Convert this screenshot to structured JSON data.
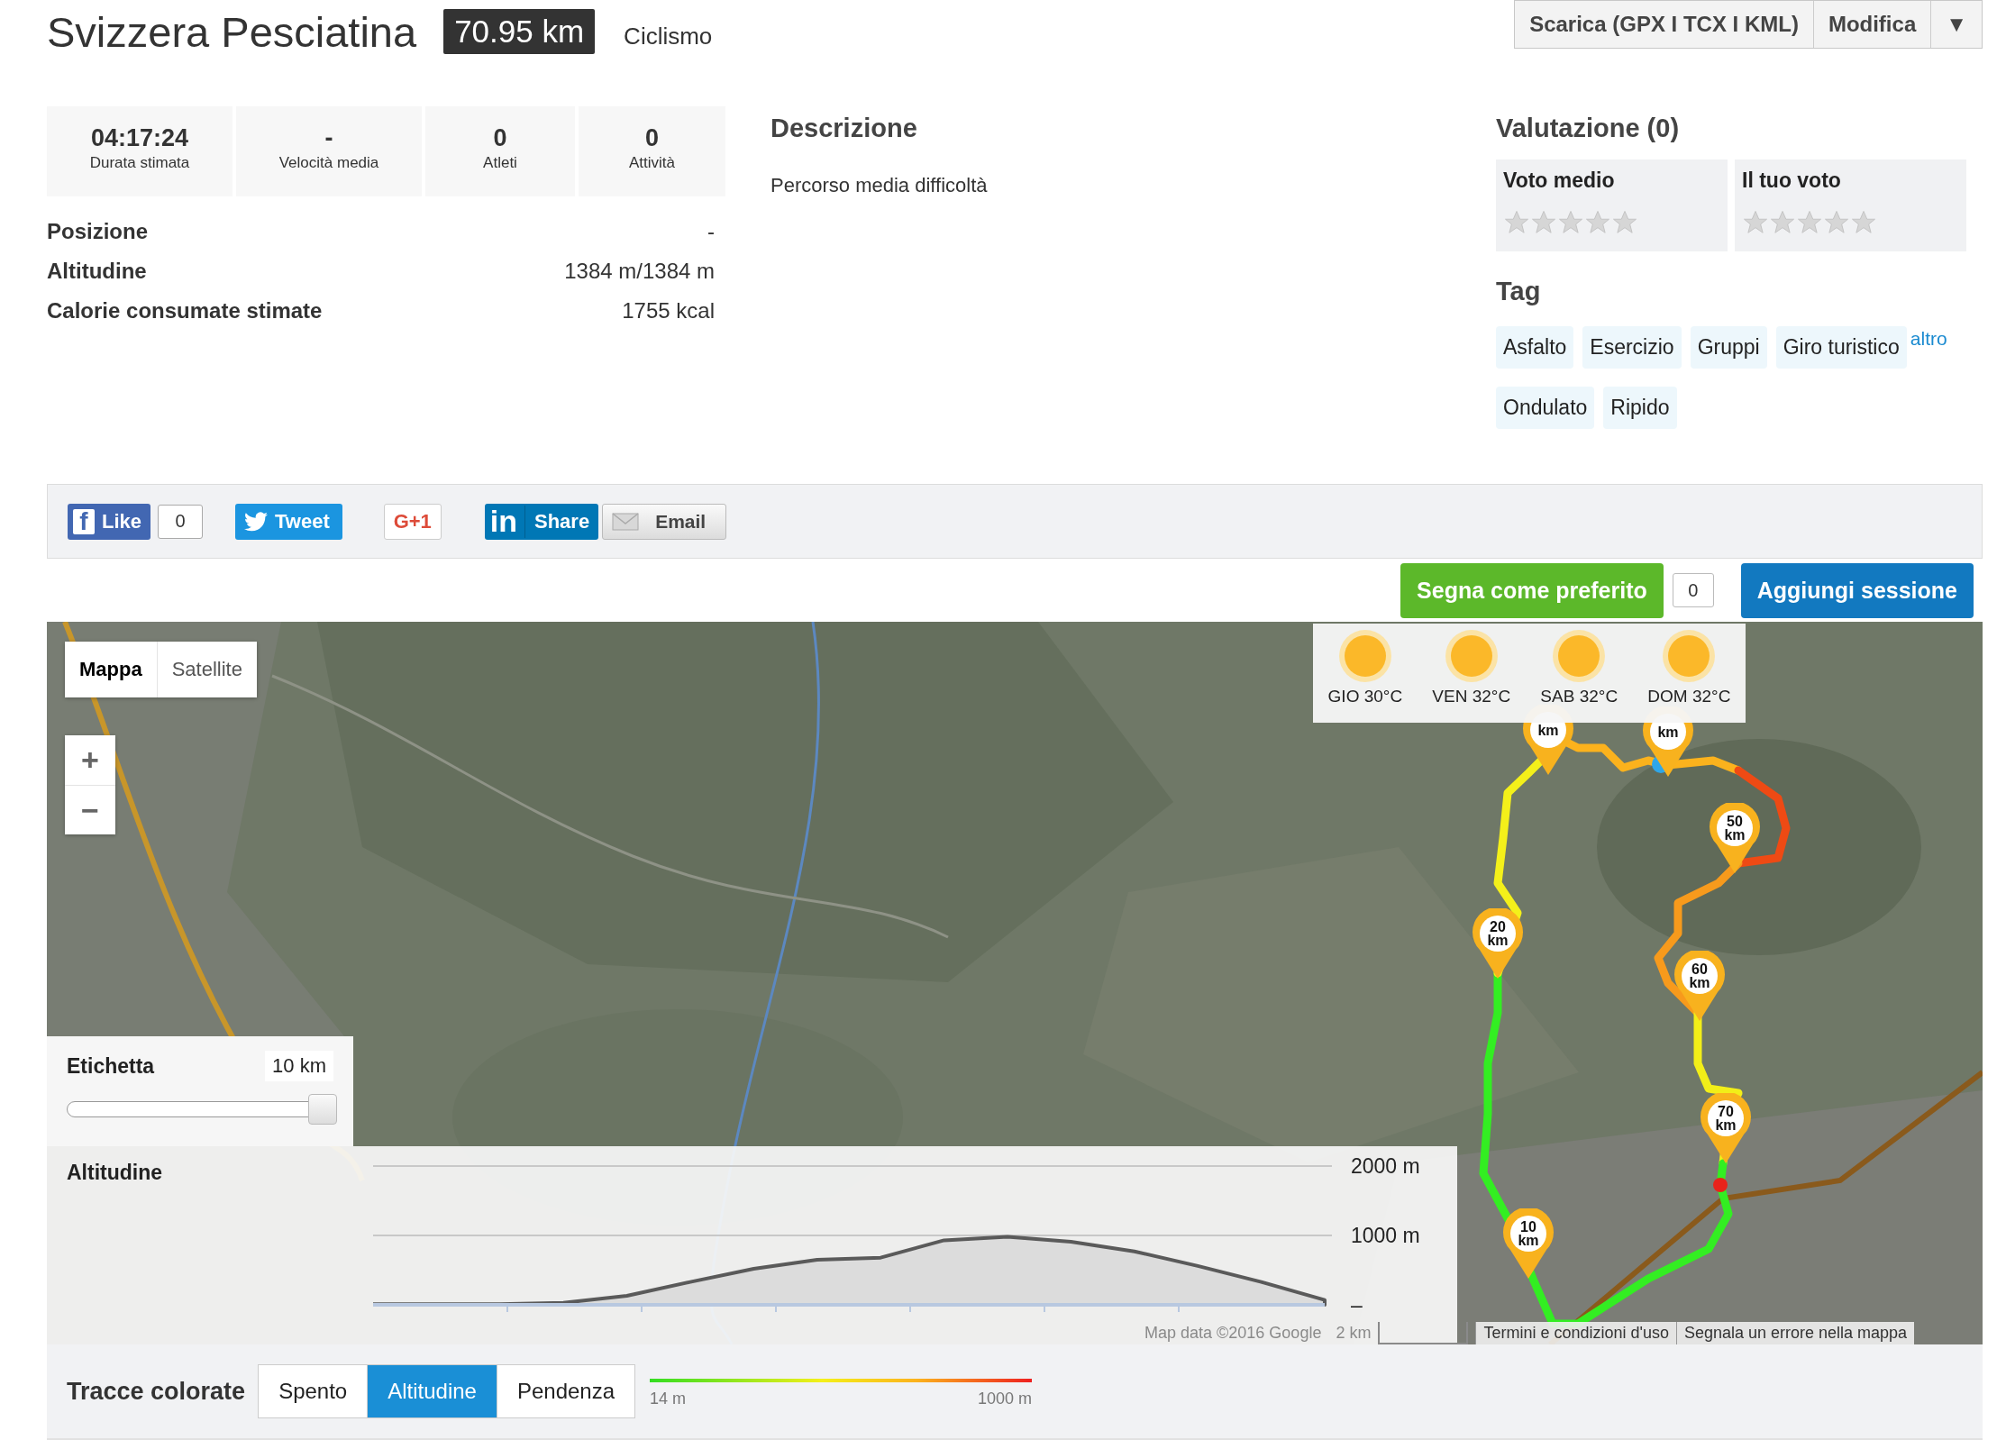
{
  "header": {
    "title": "Svizzera Pesciatina",
    "distance": "70.95 km",
    "sport": "Ciclismo",
    "actions": [
      {
        "label": "Scarica (GPX I TCX I KML)"
      },
      {
        "label": "Modifica"
      },
      {
        "label": "▼"
      }
    ]
  },
  "stats": [
    {
      "value": "04:17:24",
      "label": "Durata stimata"
    },
    {
      "value": "-",
      "label": "Velocità media"
    },
    {
      "value": "0",
      "label": "Atleti"
    },
    {
      "value": "0",
      "label": "Attività"
    }
  ],
  "info": [
    {
      "label": "Posizione",
      "value": "-"
    },
    {
      "label": "Altitudine",
      "value": "1384 m/1384 m"
    },
    {
      "label": "Calorie consumate stimate",
      "value": "1755 kcal"
    }
  ],
  "description": {
    "title": "Descrizione",
    "text": "Percorso media difficoltà"
  },
  "rating": {
    "title": "Valutazione (0)",
    "boxes": [
      {
        "label": "Voto medio",
        "stars": 0
      },
      {
        "label": "Il tuo voto",
        "stars": 0
      }
    ]
  },
  "tags": {
    "title": "Tag",
    "items": [
      "Asfalto",
      "Esercizio",
      "Gruppi",
      "Giro turistico"
    ],
    "more": "altro",
    "items_after": [
      "Ondulato",
      "Ripido"
    ]
  },
  "social": [
    {
      "kind": "facebook",
      "logo": "f",
      "label": "Like",
      "count": "0"
    },
    {
      "kind": "twitter",
      "label": "Tweet"
    },
    {
      "kind": "gplus",
      "label": "G+1"
    },
    {
      "kind": "linkedin",
      "logo": "in",
      "label": "Share"
    },
    {
      "kind": "email",
      "label": "Email"
    }
  ],
  "actions": {
    "favorite": {
      "label": "Segna come preferito",
      "count": "0"
    },
    "add_session": {
      "label": "Aggiungi sessione"
    }
  },
  "map": {
    "map_types": [
      {
        "label": "Mappa",
        "selected": true
      },
      {
        "label": "Satellite",
        "selected": false
      }
    ],
    "zoom": [
      "+",
      "−"
    ],
    "weather": [
      {
        "label": "GIO 30°C"
      },
      {
        "label": "VEN 32°C"
      },
      {
        "label": "SAB 32°C"
      },
      {
        "label": "DOM 32°C"
      }
    ],
    "markers": [
      {
        "label": "10 km"
      },
      {
        "label": "20 km"
      },
      {
        "label": "km"
      },
      {
        "label": "km"
      },
      {
        "label": "50 km"
      },
      {
        "label": "60 km"
      },
      {
        "label": "70 km"
      }
    ],
    "label_slider": {
      "title": "Etichetta",
      "value": "10 km",
      "level": 1
    },
    "attribution": [
      "Map data ©2016 Google",
      "2 km",
      "Termini e condizioni d'uso",
      "Segnala un errore nella mappa"
    ]
  },
  "altitude": {
    "title": "Altitudine",
    "chart_data": {
      "type": "area",
      "values": [
        10,
        10,
        10,
        30,
        130,
        330,
        520,
        650,
        680,
        930,
        980,
        910,
        770,
        560,
        330,
        70
      ],
      "ylim": [
        0,
        2000
      ],
      "yticks": [
        {
          "value": 0,
          "label": "–"
        },
        {
          "value": 1000,
          "label": "1000 m"
        },
        {
          "value": 2000,
          "label": "2000 m"
        }
      ]
    }
  },
  "track": {
    "title": "Tracce colorate",
    "modes": [
      {
        "label": "Spento",
        "selected": false
      },
      {
        "label": "Altitudine",
        "selected": true
      },
      {
        "label": "Pendenza",
        "selected": false
      }
    ],
    "legend": {
      "min": "14 m",
      "max": "1000 m"
    }
  }
}
